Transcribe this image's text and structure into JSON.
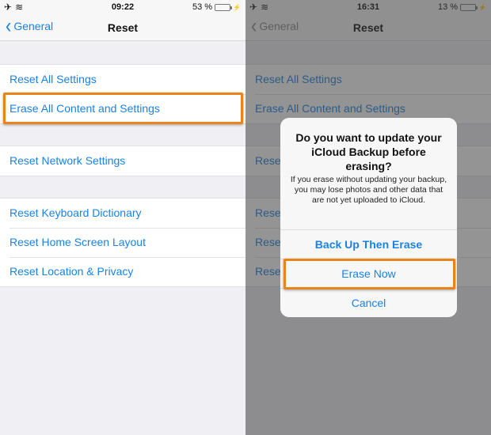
{
  "left_screen": {
    "status": {
      "time": "09:22",
      "battery_text": "53 %",
      "battery_level": 0.53,
      "battery_color": "#4cd964",
      "icons": [
        "airplane-icon",
        "wifi-icon"
      ]
    },
    "nav": {
      "back_label": "General",
      "title": "Reset"
    },
    "groups": [
      {
        "items": [
          {
            "label": "Reset All Settings"
          },
          {
            "label": "Erase All Content and Settings",
            "highlighted": true
          }
        ]
      },
      {
        "items": [
          {
            "label": "Reset Network Settings"
          }
        ]
      },
      {
        "items": [
          {
            "label": "Reset Keyboard Dictionary"
          },
          {
            "label": "Reset Home Screen Layout"
          },
          {
            "label": "Reset Location & Privacy"
          }
        ]
      }
    ]
  },
  "right_screen": {
    "status": {
      "time": "16:31",
      "battery_text": "13 %",
      "battery_level": 0.13,
      "battery_color": "#ff3b30"
    },
    "nav": {
      "back_label": "General",
      "title": "Reset"
    },
    "groups": [
      {
        "items": [
          {
            "label": "Reset All Settings"
          },
          {
            "label": "Erase All Content and Settings"
          }
        ]
      },
      {
        "items": [
          {
            "label": "Reset Network Settings"
          }
        ]
      },
      {
        "items": [
          {
            "label": "Reset Keyboard Dictionary"
          },
          {
            "label": "Reset Home Screen Layout"
          },
          {
            "label": "Reset Location & Privacy"
          }
        ]
      }
    ],
    "alert": {
      "title": "Do you want to update your iCloud Backup before erasing?",
      "message": "If you erase without updating your backup, you may lose photos and other data that are not yet uploaded to iCloud.",
      "buttons": [
        {
          "label": "Back Up Then Erase"
        },
        {
          "label": "Erase Now",
          "highlighted": true
        },
        {
          "label": "Cancel"
        }
      ]
    }
  },
  "colors": {
    "accent": "#1a82e2",
    "highlight": "#e8841a"
  }
}
